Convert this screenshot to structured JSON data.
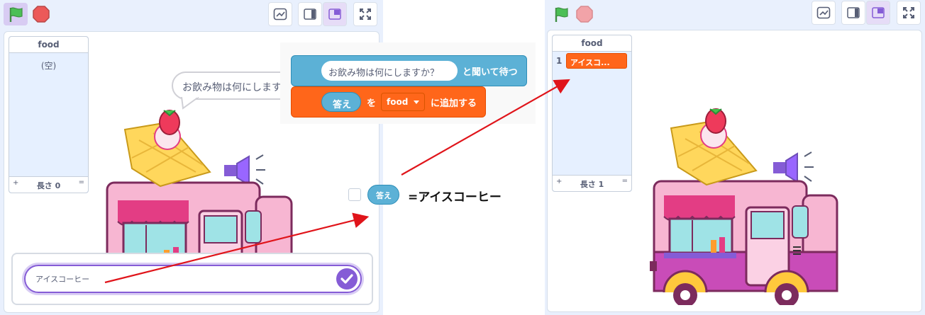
{
  "left_stage": {
    "list_monitor": {
      "title": "food",
      "empty_label": "(空)",
      "length_label": "長さ 0",
      "add_symbol": "+",
      "resize_symbol": "="
    },
    "speech_bubble": "お飲み物は何にしますか？",
    "ask_input": {
      "value": "アイスコーヒー"
    }
  },
  "right_stage": {
    "list_monitor": {
      "title": "food",
      "items": [
        {
          "index": "1",
          "value": "アイスコ..."
        }
      ],
      "length_label": "長さ 1",
      "add_symbol": "+",
      "resize_symbol": "="
    }
  },
  "code_blocks": {
    "ask_block": {
      "input_text": "お飲み物は何にしますか？",
      "suffix": "と聞いて待つ"
    },
    "add_block": {
      "reporter": "答え",
      "particle": "を",
      "list_name": "food",
      "suffix": "に追加する"
    }
  },
  "answer_reporter": {
    "label": "答え",
    "equals_text": "=アイスコーヒー"
  },
  "colors": {
    "sensing_blue": "#5cb1d6",
    "list_orange": "#ff661a",
    "panel_bg": "#e9f0fd",
    "arrow_red": "#e0141a",
    "green_flag": "#4cbf56",
    "stop_red": "#ec5959",
    "accent_purple": "#855cd6"
  },
  "icons": [
    "green-flag-icon",
    "stop-icon",
    "graph-icon",
    "small-stage-icon",
    "normal-stage-icon",
    "fullscreen-icon",
    "checkmark-icon",
    "dropdown-arrow-icon"
  ]
}
